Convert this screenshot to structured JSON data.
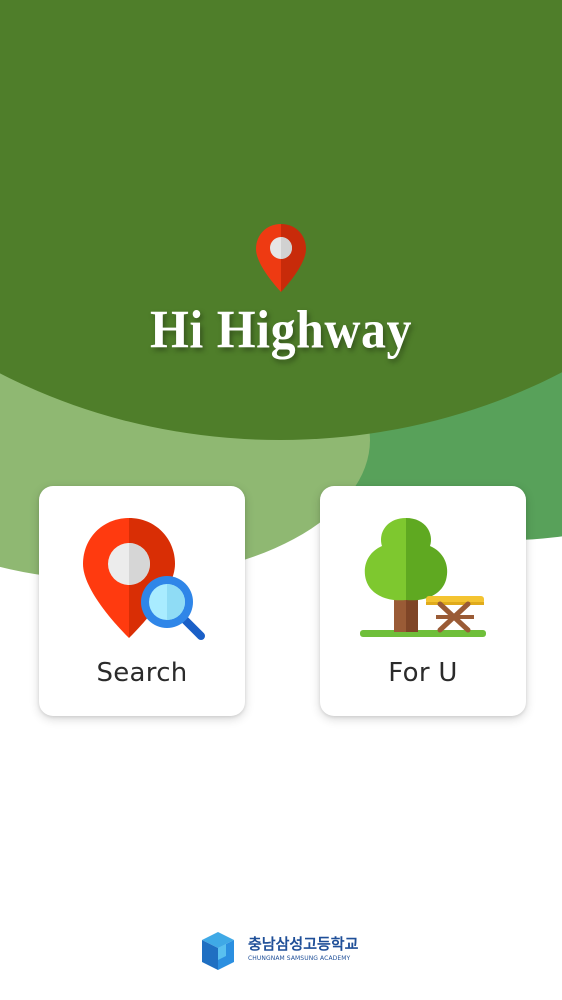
{
  "app": {
    "title": "Hi Highway"
  },
  "header": {
    "pin_icon": "location-pin-icon",
    "background_color": "#4f7e2a",
    "accent_colors": [
      "#8fb872",
      "#58a15a"
    ]
  },
  "menu": {
    "search": {
      "label": "Search",
      "icon": "location-search-icon"
    },
    "for_u": {
      "label": "For U",
      "icon": "tree-picnic-table-icon"
    }
  },
  "footer": {
    "school_name": "충남삼성고등학교",
    "school_name_en": "CHUNGNAM SAMSUNG ACADEMY",
    "logo_color": "#1f4f98"
  }
}
